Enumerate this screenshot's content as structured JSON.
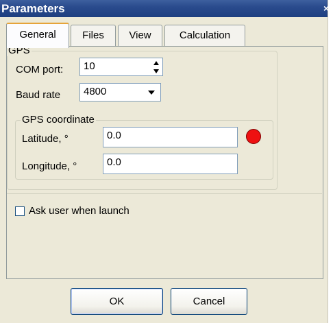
{
  "window": {
    "title": "Parameters",
    "close_glyph": "×"
  },
  "tabs": [
    {
      "label": "General",
      "active": true
    },
    {
      "label": "Files",
      "active": false
    },
    {
      "label": "View",
      "active": false
    },
    {
      "label": "Calculation",
      "active": false
    }
  ],
  "gps": {
    "group_label": "GPS",
    "com_port": {
      "label": "COM port:",
      "value": "10"
    },
    "baud_rate": {
      "label": "Baud rate",
      "value": "4800"
    },
    "coordinate": {
      "group_label": "GPS coordinate",
      "latitude": {
        "label": "Latitude, °",
        "value": "0.0"
      },
      "longitude": {
        "label": "Longitude, °",
        "value": "0.0"
      },
      "status_color": "#ee1111"
    }
  },
  "options": {
    "ask_user_label": "Ask user when launch",
    "ask_user_checked": false
  },
  "buttons": {
    "ok": "OK",
    "cancel": "Cancel"
  }
}
